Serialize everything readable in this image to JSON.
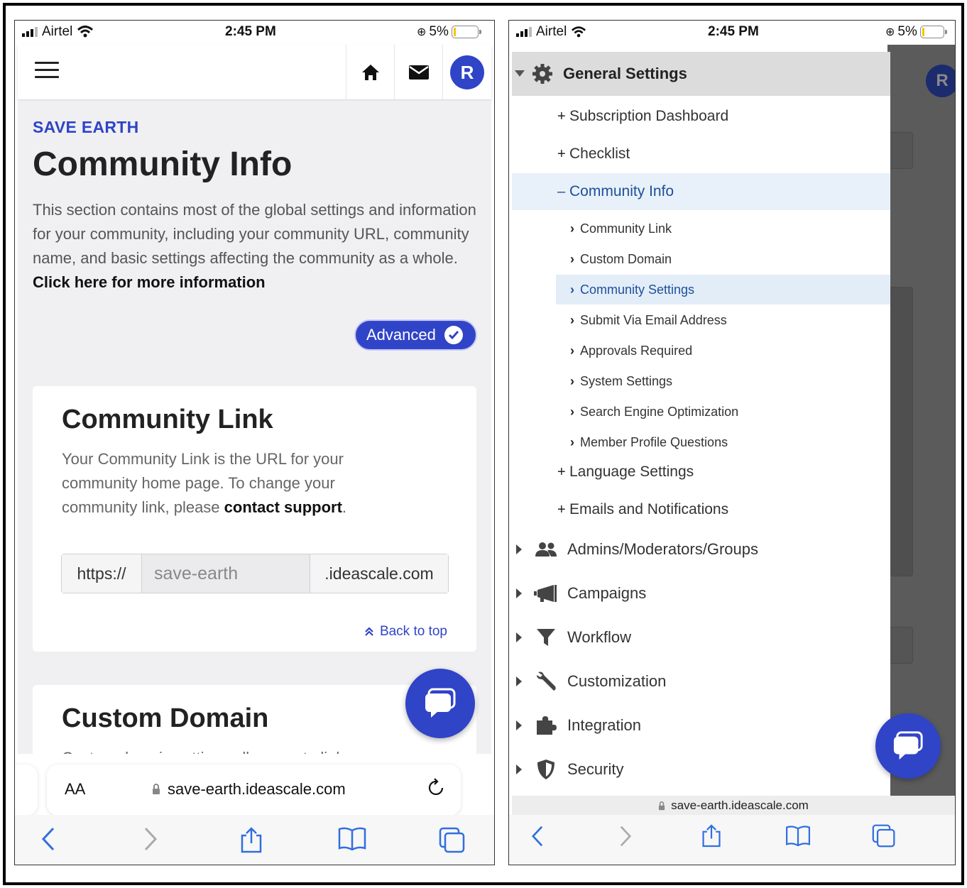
{
  "left": {
    "status": {
      "carrier": "Airtel",
      "time": "2:45 PM",
      "battery": "5%"
    },
    "header": {
      "avatar_initial": "R"
    },
    "eyebrow": "SAVE EARTH",
    "title": "Community Info",
    "intro_text": "This section contains most of the global settings and information for your community, including your community URL, community name, and basic settings affecting the community as a whole.",
    "intro_link": "Click here for more information",
    "advanced_label": "Advanced",
    "card_link": {
      "title": "Community Link",
      "desc": "Your Community Link is the URL for your community home page. To change your community link, please",
      "desc_link": "contact support",
      "desc_end": ".",
      "prefix": "https://",
      "subdomain": "save-earth",
      "suffix": ".ideascale.com",
      "back_to_top": "Back to top"
    },
    "card_domain": {
      "title": "Custom Domain",
      "desc": "Custom domain settings allow you to link your"
    },
    "safari": {
      "aa": "AA",
      "url": "save-earth.ideascale.com"
    }
  },
  "right": {
    "status": {
      "carrier": "Airtel",
      "time": "2:45 PM",
      "battery": "5%"
    },
    "header": {
      "avatar_initial": "R"
    },
    "drawer_title": "General Settings",
    "level2": [
      {
        "sym": "+",
        "label": "Subscription Dashboard"
      },
      {
        "sym": "+",
        "label": "Checklist"
      },
      {
        "sym": "–",
        "label": "Community Info"
      }
    ],
    "level3": [
      "Community Link",
      "Custom Domain",
      "Community Settings",
      "Submit Via Email Address",
      "Approvals Required",
      "System Settings",
      "Search Engine Optimization",
      "Member Profile Questions"
    ],
    "level2b": [
      {
        "sym": "+",
        "label": "Language Settings"
      },
      {
        "sym": "+",
        "label": "Emails and Notifications"
      }
    ],
    "top_items": [
      {
        "label": "Admins/Moderators/Groups",
        "icon": "users-icon"
      },
      {
        "label": "Campaigns",
        "icon": "megaphone-icon"
      },
      {
        "label": "Workflow",
        "icon": "funnel-icon"
      },
      {
        "label": "Customization",
        "icon": "wrench-icon"
      },
      {
        "label": "Integration",
        "icon": "puzzle-icon"
      },
      {
        "label": "Security",
        "icon": "shield-icon"
      }
    ],
    "url": "save-earth.ideascale.com"
  },
  "colors": {
    "brand": "#2f44c7",
    "active_bg": "#e8f1f9",
    "active_text": "#1d4f9a"
  }
}
